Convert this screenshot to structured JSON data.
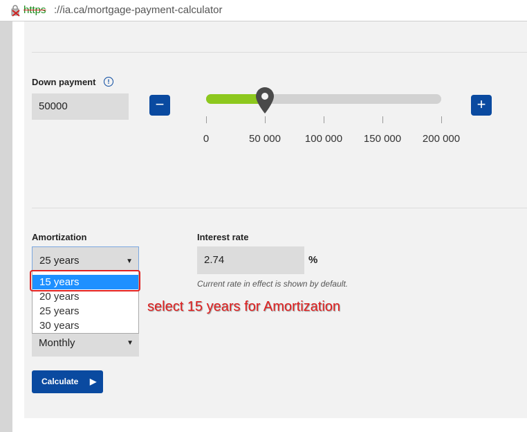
{
  "browser": {
    "url_scheme": "https",
    "url_rest": "://ia.ca/mortgage-payment-calculator"
  },
  "down_payment": {
    "label": "Down payment",
    "value": "50000",
    "minus_label": "−",
    "plus_label": "+",
    "slider": {
      "min": 0,
      "max": 200000,
      "value": 50000,
      "fill_fraction": 0.25,
      "ticks": [
        "0",
        "50 000",
        "100 000",
        "150 000",
        "200 000"
      ]
    }
  },
  "amortization": {
    "label": "Amortization",
    "selected": "25 years",
    "options": [
      "15 years",
      "20 years",
      "25 years",
      "30 years"
    ],
    "highlighted": "15 years"
  },
  "interest_rate": {
    "label": "Interest rate",
    "value": "2.74",
    "unit": "%",
    "note": "Current rate in effect is shown by default."
  },
  "frequency": {
    "selected": "Monthly"
  },
  "calculate": {
    "label": "Calculate"
  },
  "annotation": {
    "text": "select 15 years for Amortization"
  },
  "colors": {
    "accent": "#0a4aa0",
    "slider_fill": "#8dc81e",
    "highlight": "#1e90ff",
    "annotation": "#e02020"
  }
}
